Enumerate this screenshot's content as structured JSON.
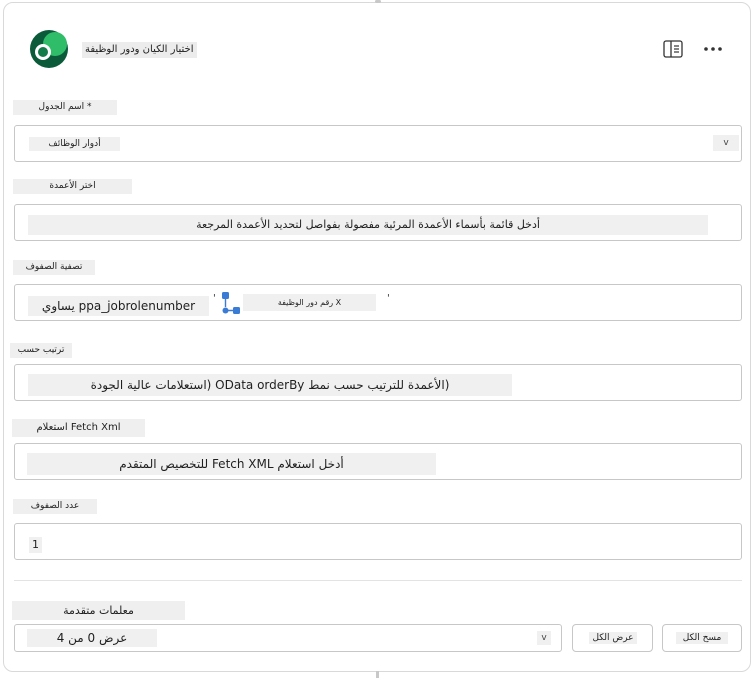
{
  "header": {
    "title": "اختيار الكيان ودور الوظيفة",
    "logo_icon": "dynamics-logo-icon",
    "sidebar_toggle_icon": "sidebar-panel-icon",
    "more_icon": "more-ellipsis-icon"
  },
  "fields": {
    "table": {
      "label": "* اسم الجدول",
      "value": "أدوار الوظائف"
    },
    "column": {
      "label": "اختر الأعمدة",
      "value": "أدخل قائمة بأسماء الأعمدة المرئية مفصولة بفواصل لتحديد الأعمدة المرجعة"
    },
    "row_filter": {
      "label": "تصفية الصفوف",
      "chip_text": "ppa_jobrolenumber يساوي",
      "lookup_text": "X رقم دور الوظيفة"
    },
    "sort": {
      "label": "ترتيب حسب",
      "value": "(الأعمدة للترتيب حسب نمط OData orderBy (استعلامات عالية الجودة"
    },
    "fetch_xml": {
      "label": "Fetch Xml استعلام",
      "value": "أدخل استعلام Fetch XML للتخصيص المتقدم"
    },
    "row_count": {
      "label": "عدد الصفوف",
      "value": "1"
    }
  },
  "advanced": {
    "label": "معلمات متقدمة",
    "value": "عرض 0 من 4",
    "show_all": "عرض الكل",
    "hide_all": "مسح الكل"
  },
  "colors": {
    "logo_dark": "#0b5a3a",
    "logo_light": "#2fbd6a",
    "filter_icon": "#3a7bd5"
  }
}
